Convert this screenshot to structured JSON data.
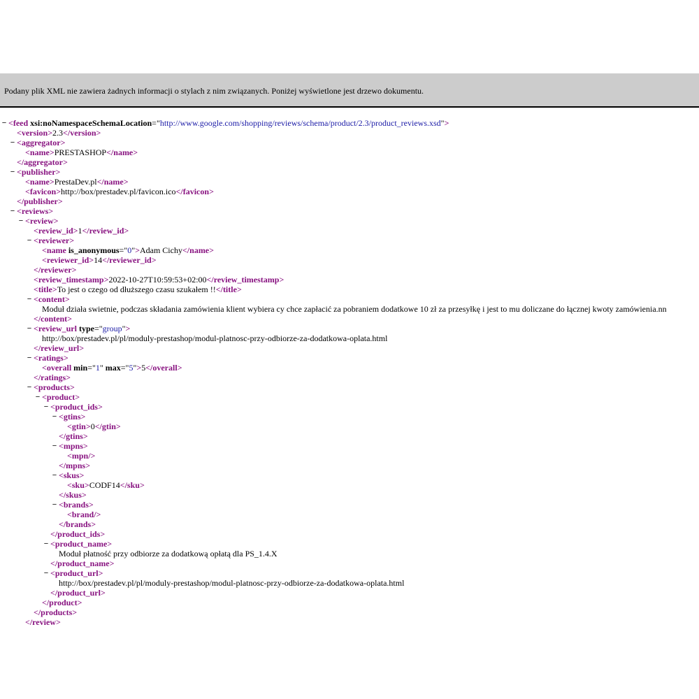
{
  "info_bar": {
    "message": "Podany plik XML nie zawiera żadnych informacji o stylach z nim związanych. Poniżej wyświetlone jest drzewo dokumentu."
  },
  "tree": [
    {
      "depth": 0,
      "collapsible": true,
      "kind": "open",
      "tag": "feed",
      "attrs": [
        {
          "name": "xsi:noNamespaceSchemaLocation",
          "value": "http://www.google.com/shopping/reviews/schema/product/2.3/product_reviews.xsd"
        }
      ]
    },
    {
      "depth": 1,
      "kind": "leaf",
      "tag": "version",
      "text": "2.3"
    },
    {
      "depth": 1,
      "collapsible": true,
      "kind": "open",
      "tag": "aggregator"
    },
    {
      "depth": 2,
      "kind": "leaf",
      "tag": "name",
      "text": "PRESTASHOP"
    },
    {
      "depth": 1,
      "kind": "close",
      "tag": "aggregator"
    },
    {
      "depth": 1,
      "collapsible": true,
      "kind": "open",
      "tag": "publisher"
    },
    {
      "depth": 2,
      "kind": "leaf",
      "tag": "name",
      "text": "PrestaDev.pl"
    },
    {
      "depth": 2,
      "kind": "leaf",
      "tag": "favicon",
      "text": "http://box/prestadev.pl/favicon.ico"
    },
    {
      "depth": 1,
      "kind": "close",
      "tag": "publisher"
    },
    {
      "depth": 1,
      "collapsible": true,
      "kind": "open",
      "tag": "reviews"
    },
    {
      "depth": 2,
      "collapsible": true,
      "kind": "open",
      "tag": "review"
    },
    {
      "depth": 3,
      "kind": "leaf",
      "tag": "review_id",
      "text": "1"
    },
    {
      "depth": 3,
      "collapsible": true,
      "kind": "open",
      "tag": "reviewer"
    },
    {
      "depth": 4,
      "kind": "leaf",
      "tag": "name",
      "attrs": [
        {
          "name": "is_anonymous",
          "value": "0"
        }
      ],
      "text": "Adam Cichy"
    },
    {
      "depth": 4,
      "kind": "leaf",
      "tag": "reviewer_id",
      "text": "14"
    },
    {
      "depth": 3,
      "kind": "close",
      "tag": "reviewer"
    },
    {
      "depth": 3,
      "kind": "leaf",
      "tag": "review_timestamp",
      "text": "2022-10-27T10:59:53+02:00"
    },
    {
      "depth": 3,
      "kind": "leaf",
      "tag": "title",
      "text": "To jest o czego od dłuższego czasu szukałem !!"
    },
    {
      "depth": 3,
      "collapsible": true,
      "kind": "open",
      "tag": "content"
    },
    {
      "depth": 4,
      "kind": "text",
      "text": "Moduł działa swietnie, podczas składania zamówienia klient wybiera cy chce zapłacić za pobraniem dodatkowe 10 zł za przesyłkę i jest to mu doliczane do łącznej kwoty zamówienia.nn"
    },
    {
      "depth": 3,
      "kind": "close",
      "tag": "content"
    },
    {
      "depth": 3,
      "collapsible": true,
      "kind": "open",
      "tag": "review_url",
      "attrs": [
        {
          "name": "type",
          "value": "group"
        }
      ]
    },
    {
      "depth": 4,
      "kind": "text",
      "text": "http://box/prestadev.pl/pl/moduly-prestashop/modul-platnosc-przy-odbiorze-za-dodatkowa-oplata.html"
    },
    {
      "depth": 3,
      "kind": "close",
      "tag": "review_url"
    },
    {
      "depth": 3,
      "collapsible": true,
      "kind": "open",
      "tag": "ratings"
    },
    {
      "depth": 4,
      "kind": "leaf",
      "tag": "overall",
      "attrs": [
        {
          "name": "min",
          "value": "1"
        },
        {
          "name": "max",
          "value": "5"
        }
      ],
      "text": "5"
    },
    {
      "depth": 3,
      "kind": "close",
      "tag": "ratings"
    },
    {
      "depth": 3,
      "collapsible": true,
      "kind": "open",
      "tag": "products"
    },
    {
      "depth": 4,
      "collapsible": true,
      "kind": "open",
      "tag": "product"
    },
    {
      "depth": 5,
      "collapsible": true,
      "kind": "open",
      "tag": "product_ids"
    },
    {
      "depth": 6,
      "collapsible": true,
      "kind": "open",
      "tag": "gtins"
    },
    {
      "depth": 7,
      "kind": "leaf",
      "tag": "gtin",
      "text": "0"
    },
    {
      "depth": 6,
      "kind": "close",
      "tag": "gtins"
    },
    {
      "depth": 6,
      "collapsible": true,
      "kind": "open",
      "tag": "mpns"
    },
    {
      "depth": 7,
      "kind": "empty",
      "tag": "mpn"
    },
    {
      "depth": 6,
      "kind": "close",
      "tag": "mpns"
    },
    {
      "depth": 6,
      "collapsible": true,
      "kind": "open",
      "tag": "skus"
    },
    {
      "depth": 7,
      "kind": "leaf",
      "tag": "sku",
      "text": "CODF14"
    },
    {
      "depth": 6,
      "kind": "close",
      "tag": "skus"
    },
    {
      "depth": 6,
      "collapsible": true,
      "kind": "open",
      "tag": "brands"
    },
    {
      "depth": 7,
      "kind": "empty",
      "tag": "brand"
    },
    {
      "depth": 6,
      "kind": "close",
      "tag": "brands"
    },
    {
      "depth": 5,
      "kind": "close",
      "tag": "product_ids"
    },
    {
      "depth": 5,
      "collapsible": true,
      "kind": "open",
      "tag": "product_name"
    },
    {
      "depth": 6,
      "kind": "text",
      "text": "Moduł płatność przy odbiorze za dodatkową opłatą dla PS_1.4.X"
    },
    {
      "depth": 5,
      "kind": "close",
      "tag": "product_name"
    },
    {
      "depth": 5,
      "collapsible": true,
      "kind": "open",
      "tag": "product_url"
    },
    {
      "depth": 6,
      "kind": "text",
      "text": "http://box/prestadev.pl/pl/moduly-prestashop/modul-platnosc-przy-odbiorze-za-dodatkowa-oplata.html"
    },
    {
      "depth": 5,
      "kind": "close",
      "tag": "product_url"
    },
    {
      "depth": 4,
      "kind": "close",
      "tag": "product"
    },
    {
      "depth": 3,
      "kind": "close",
      "tag": "products"
    },
    {
      "depth": 2,
      "kind": "close",
      "tag": "review"
    }
  ],
  "toggle_symbol": "−",
  "colors": {
    "tag": "#881280",
    "attr_value": "#1a1aa6",
    "info_bar": "#cccccc"
  }
}
